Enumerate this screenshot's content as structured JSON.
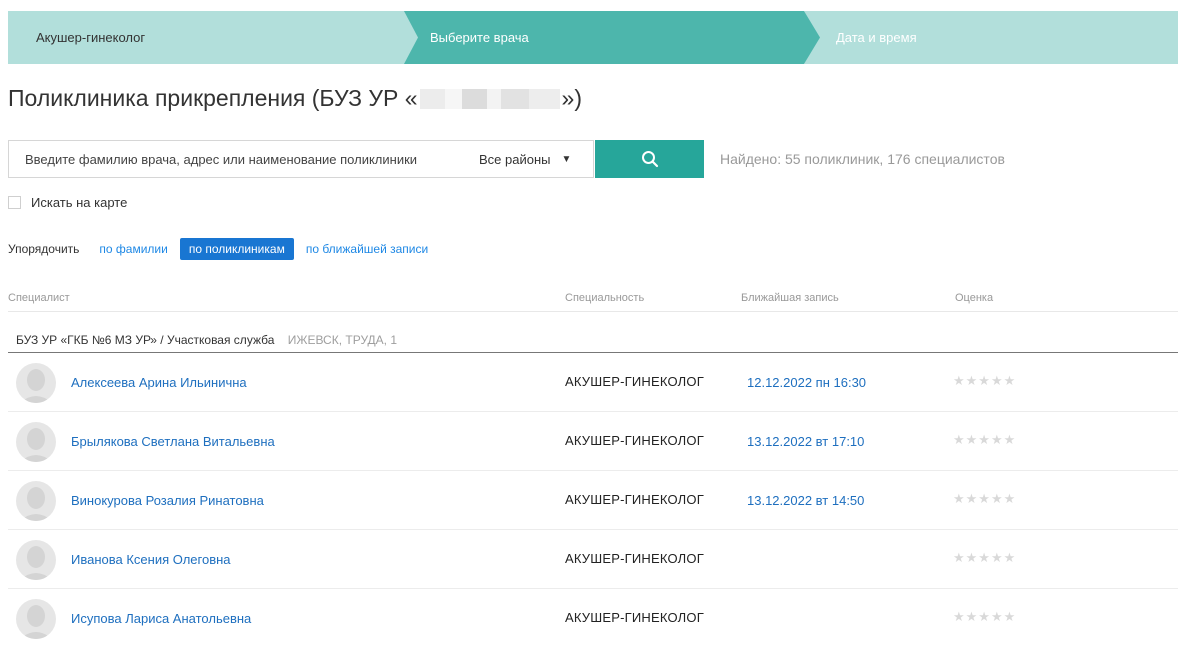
{
  "steps": [
    {
      "label": "Акушер-гинеколог"
    },
    {
      "label": "Выберите врача"
    },
    {
      "label": "Дата и время"
    }
  ],
  "title": {
    "prefix": "Поликлиника прикрепления (БУЗ УР «",
    "suffix": "»)"
  },
  "search": {
    "placeholder": "Введите фамилию врача, адрес или наименование поликлиники",
    "value": "",
    "district": "Все районы",
    "found": "Найдено: 55 поликлиник, 176 специалистов"
  },
  "map_checkbox": {
    "label": "Искать на карте",
    "checked": false
  },
  "sort": {
    "label": "Упорядочить",
    "options": [
      "по фамилии",
      "по поликлиникам",
      "по ближайшей записи"
    ],
    "active": "по поликлиникам"
  },
  "table": {
    "headers": [
      "Специалист",
      "Специальность",
      "Ближайшая запись",
      "Оценка"
    ],
    "group": {
      "name": "БУЗ УР «ГКБ №6 МЗ УР» / Участковая служба",
      "address": "ИЖЕВСК, ТРУДА, 1"
    },
    "rows": [
      {
        "name": "Алексеева Арина Ильинична",
        "specialty": "АКУШЕР-ГИНЕКОЛОГ",
        "slot": "12.12.2022 пн 16:30",
        "rating": "★★★★★"
      },
      {
        "name": "Брылякова Светлана Витальевна",
        "specialty": "АКУШЕР-ГИНЕКОЛОГ",
        "slot": "13.12.2022 вт 17:10",
        "rating": "★★★★★"
      },
      {
        "name": "Винокурова Розалия Ринатовна",
        "specialty": "АКУШЕР-ГИНЕКОЛОГ",
        "slot": "13.12.2022 вт 14:50",
        "rating": "★★★★★"
      },
      {
        "name": "Иванова Ксения Олеговна",
        "specialty": "АКУШЕР-ГИНЕКОЛОГ",
        "slot": "",
        "rating": "★★★★★"
      },
      {
        "name": "Исупова Лариса Анатольевна",
        "specialty": "АКУШЕР-ГИНЕКОЛОГ",
        "slot": "",
        "rating": "★★★★★"
      }
    ]
  },
  "colors": {
    "step_light": "#b2dfdb",
    "step_active": "#4db6ac",
    "search_button": "#26a69a",
    "sort_active": "#1976d2",
    "link": "#1e6fbf"
  },
  "icons": {
    "search_button": "search-icon",
    "district_arrow": "caret-down-icon",
    "avatar": "user-avatar-placeholder-icon",
    "rating": "star-icon"
  }
}
